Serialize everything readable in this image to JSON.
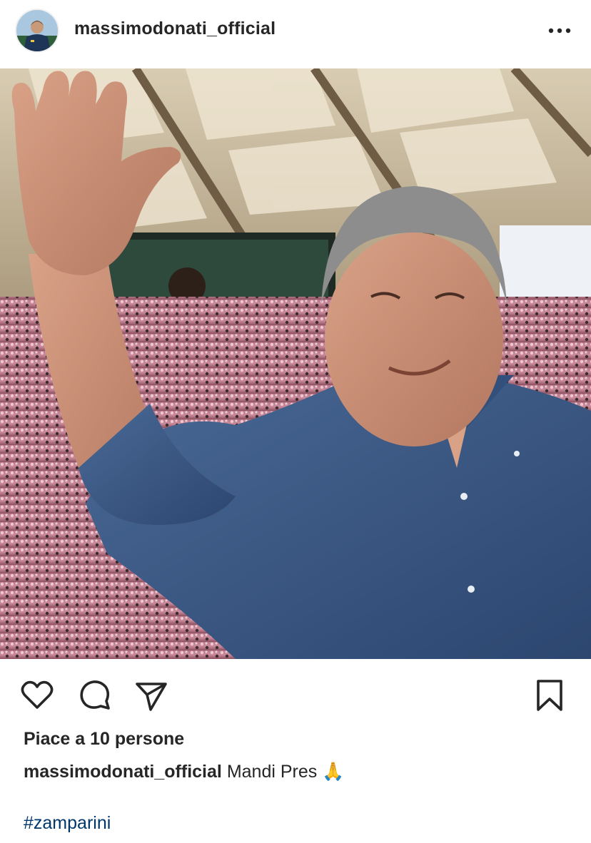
{
  "post": {
    "username": "massimodonati_official",
    "likes_text": "Piace a 10 persone",
    "caption_user": "massimodonati_official",
    "caption_text": "Mandi Pres",
    "caption_emoji": "🙏",
    "hashtag": "#zamparini"
  },
  "icons": {
    "more": "more-horizontal-icon",
    "like": "heart-icon",
    "comment": "comment-icon",
    "share": "send-icon",
    "save": "bookmark-icon"
  },
  "colors": {
    "text": "#262626",
    "hashtag": "#00376b",
    "background": "#ffffff"
  }
}
